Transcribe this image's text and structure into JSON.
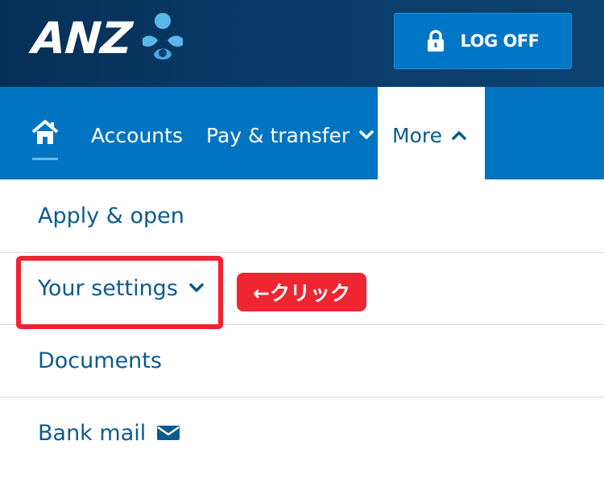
{
  "header": {
    "brand": "ANZ",
    "logoff_label": "LOG OFF"
  },
  "nav": {
    "home_icon": "home-icon",
    "accounts_label": "Accounts",
    "pay_label": "Pay & transfer",
    "more_label": "More"
  },
  "menu": {
    "items": [
      {
        "label": "Apply & open"
      },
      {
        "label": "Your settings"
      },
      {
        "label": "Documents"
      },
      {
        "label": "Bank mail"
      }
    ]
  },
  "annotation": {
    "callout_text": "←クリック"
  },
  "colors": {
    "header_bg": "#0a3b69",
    "nav_bg": "#0074c1",
    "logoff_bg": "#0076c6",
    "menu_text": "#0a5b8e",
    "highlight": "#ee2431"
  }
}
